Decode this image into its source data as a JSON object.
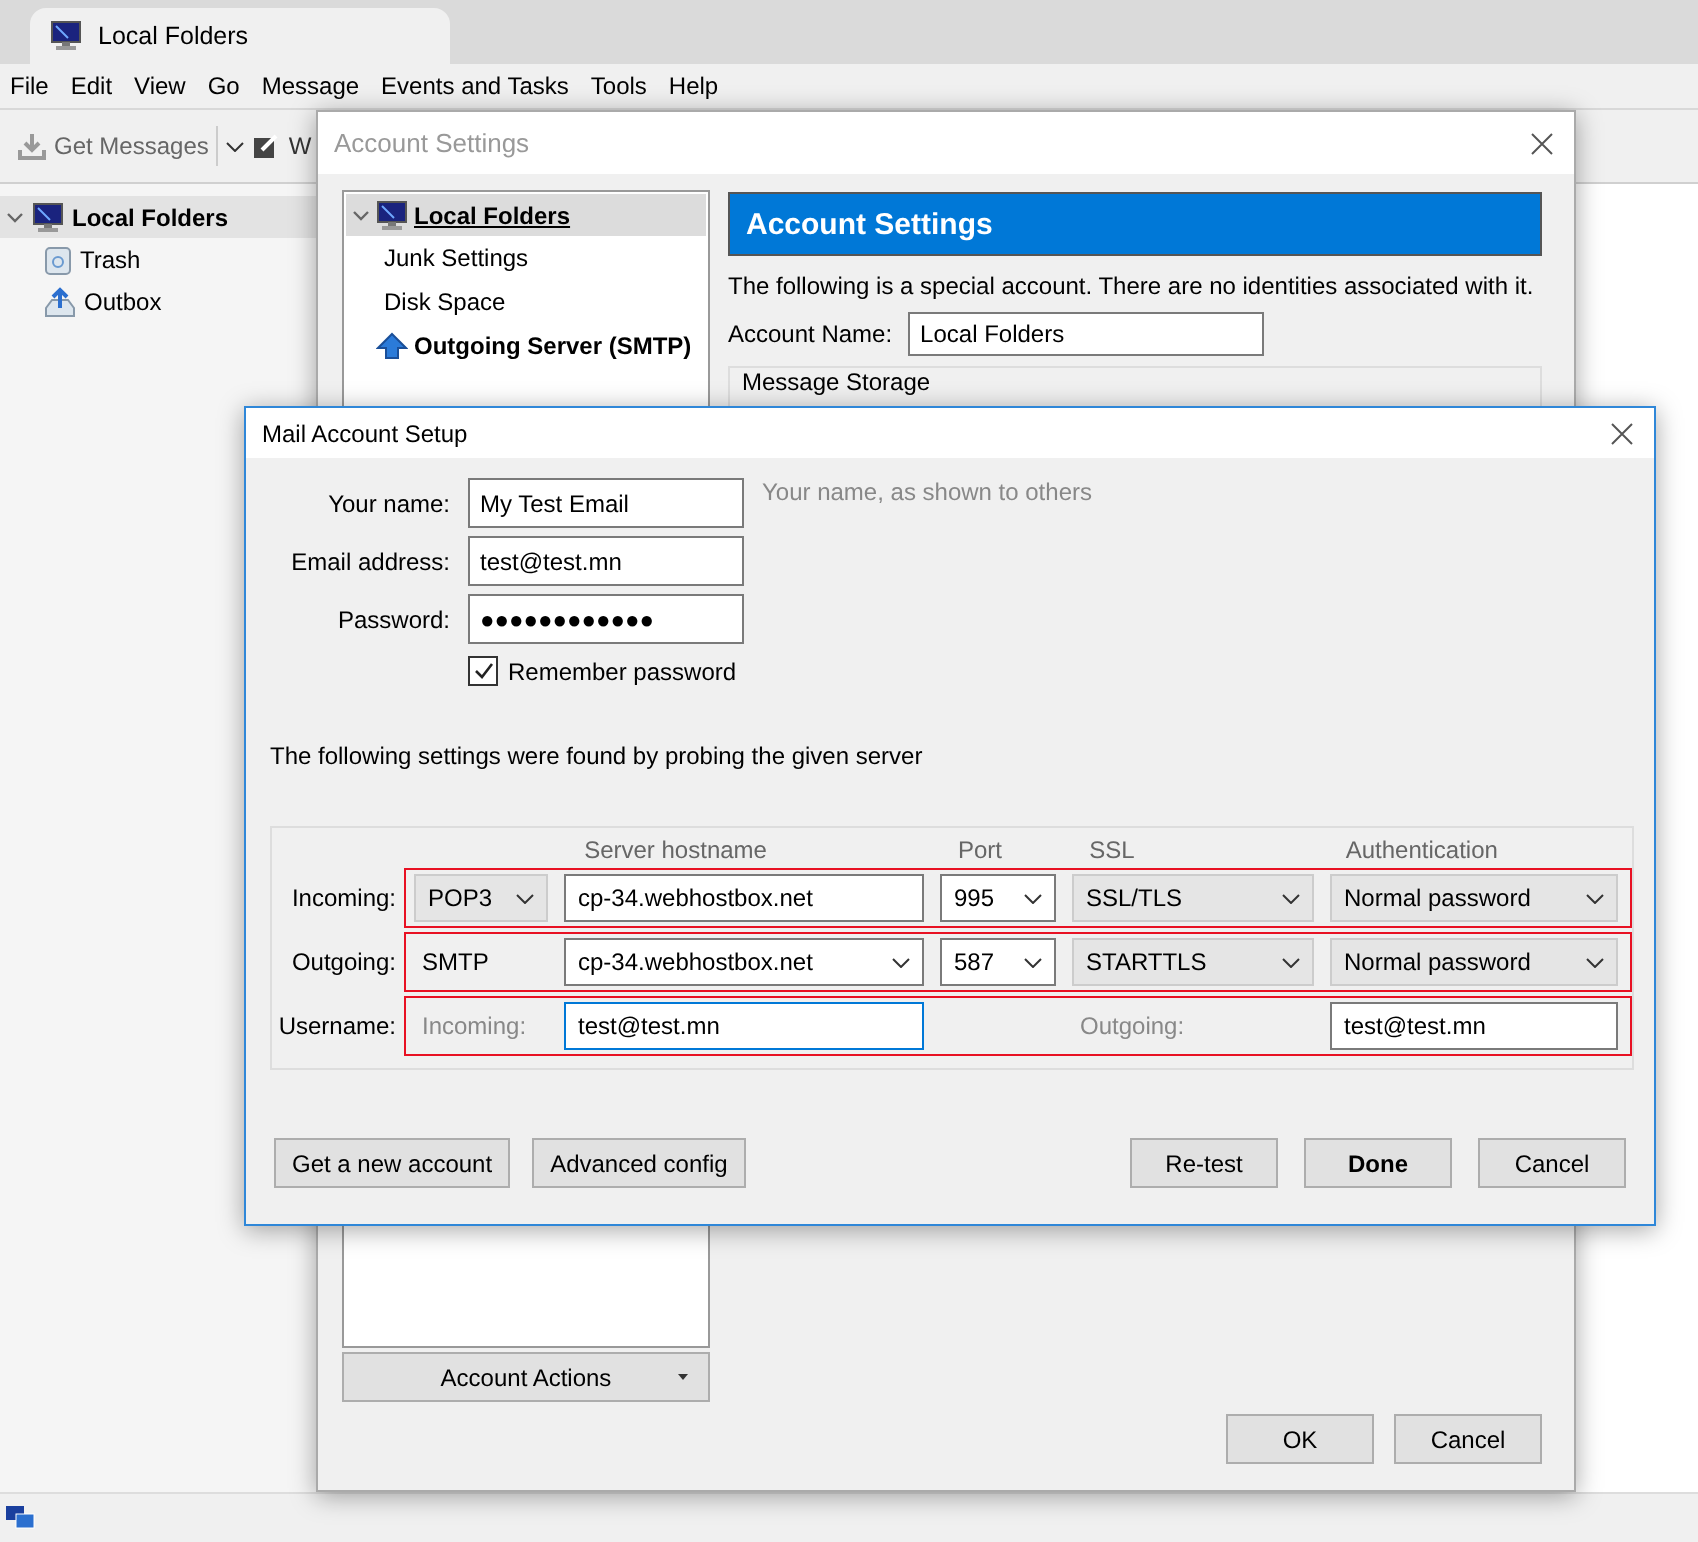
{
  "app": {
    "tab_title": "Local Folders",
    "menu": [
      "File",
      "Edit",
      "View",
      "Go",
      "Message",
      "Events and Tasks",
      "Tools",
      "Help"
    ],
    "toolbar": {
      "get_messages": "Get Messages",
      "write": "W"
    },
    "folders": [
      {
        "label": "Local Folders",
        "expanded": true,
        "selected": true,
        "children": [
          {
            "label": "Trash",
            "kind": "trash"
          },
          {
            "label": "Outbox",
            "kind": "outbox"
          }
        ]
      }
    ]
  },
  "account_settings": {
    "title": "Account Settings",
    "tree": [
      {
        "label": "Local Folders",
        "kind": "local",
        "selected": true,
        "expanded": true,
        "children": [
          {
            "label": "Junk Settings"
          },
          {
            "label": "Disk Space"
          }
        ]
      },
      {
        "label": "Outgoing Server (SMTP)",
        "kind": "smtp",
        "selected": false
      }
    ],
    "header": "Account Settings",
    "description": "The following is a special account. There are no identities associated with it.",
    "account_name_label": "Account Name:",
    "account_name": "Local Folders",
    "section_label": "Message Storage",
    "account_actions": "Account Actions",
    "buttons": [
      "OK",
      "Cancel"
    ]
  },
  "mail_setup": {
    "title": "Mail Account Setup",
    "fields": [
      {
        "label": "Your name:",
        "value": "My Test Email",
        "hint": "Your name, as shown to others"
      },
      {
        "label": "Email address:",
        "value": "test@test.mn"
      },
      {
        "label": "Password:",
        "value": "●●●●●●●●●●●●"
      }
    ],
    "remember": {
      "label": "Remember password",
      "checked": true
    },
    "probe_note": "The following settings were found by probing the given server",
    "columns": [
      "Server hostname",
      "Port",
      "SSL",
      "Authentication"
    ],
    "servers": [
      {
        "label": "Incoming:",
        "highlighted": true,
        "protocol": {
          "kind": "dropdown",
          "value": "POP3"
        },
        "hostname": {
          "kind": "input",
          "value": "cp-34.webhostbox.net"
        },
        "port": {
          "kind": "combo",
          "value": "995"
        },
        "ssl": {
          "kind": "dropdown",
          "value": "SSL/TLS"
        },
        "auth": {
          "kind": "dropdown",
          "value": "Normal password"
        }
      },
      {
        "label": "Outgoing:",
        "highlighted": true,
        "protocol": {
          "kind": "text",
          "value": "SMTP"
        },
        "hostname": {
          "kind": "combo",
          "value": "cp-34.webhostbox.net"
        },
        "port": {
          "kind": "combo",
          "value": "587"
        },
        "ssl": {
          "kind": "dropdown",
          "value": "STARTTLS"
        },
        "auth": {
          "kind": "dropdown",
          "value": "Normal password"
        }
      }
    ],
    "username": {
      "label": "Username:",
      "highlighted": true,
      "incoming_label": "Incoming:",
      "incoming": "test@test.mn",
      "incoming_focused": true,
      "outgoing_label": "Outgoing:",
      "outgoing": "test@test.mn"
    },
    "left_buttons": [
      "Get a new account",
      "Advanced config"
    ],
    "right_buttons": [
      {
        "label": "Re-test",
        "default": false
      },
      {
        "label": "Done",
        "default": true
      },
      {
        "label": "Cancel",
        "default": false
      }
    ]
  }
}
